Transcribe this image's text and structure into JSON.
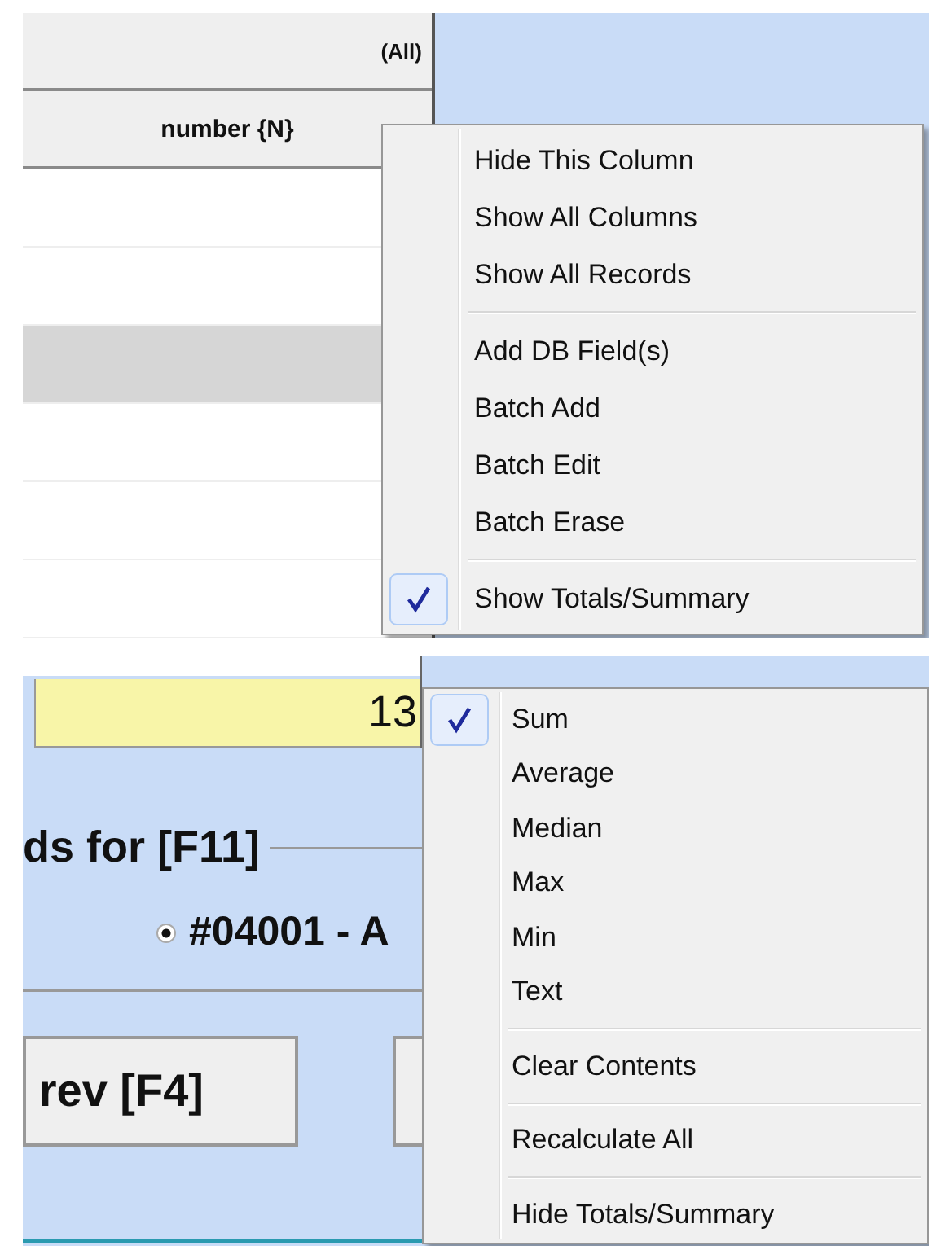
{
  "top_grid": {
    "filter_header": "(All)",
    "column_header": "number {N}",
    "rows": [
      {
        "selected": false
      },
      {
        "selected": false
      },
      {
        "selected": true
      },
      {
        "selected": false
      },
      {
        "selected": false
      },
      {
        "selected": false
      }
    ]
  },
  "column_menu": {
    "groups": [
      {
        "items": [
          {
            "label": "Hide This Column",
            "checked": false
          },
          {
            "label": "Show All Columns",
            "checked": false
          },
          {
            "label": "Show All Records",
            "checked": false
          }
        ]
      },
      {
        "items": [
          {
            "label": "Add DB Field(s)",
            "checked": false
          },
          {
            "label": "Batch Add",
            "checked": false
          },
          {
            "label": "Batch Edit",
            "checked": false
          },
          {
            "label": "Batch Erase",
            "checked": false
          }
        ]
      },
      {
        "items": [
          {
            "label": "Show Totals/Summary",
            "checked": true
          }
        ]
      }
    ]
  },
  "totals_row": {
    "value": "13"
  },
  "group_box": {
    "title": "ds for [F11]",
    "options": [
      {
        "label": "#04001 - A",
        "selected": true
      }
    ]
  },
  "buttons": [
    {
      "label": "rev [F4]"
    }
  ],
  "totals_menu": {
    "groups": [
      {
        "items": [
          {
            "label": "Sum",
            "checked": true
          },
          {
            "label": "Average",
            "checked": false
          },
          {
            "label": "Median",
            "checked": false
          },
          {
            "label": "Max",
            "checked": false
          },
          {
            "label": "Min",
            "checked": false
          },
          {
            "label": "Text",
            "checked": false
          }
        ]
      },
      {
        "items": [
          {
            "label": "Clear Contents",
            "checked": false
          }
        ]
      },
      {
        "items": [
          {
            "label": "Recalculate All",
            "checked": false
          }
        ]
      },
      {
        "items": [
          {
            "label": "Hide Totals/Summary",
            "checked": false
          }
        ]
      }
    ]
  }
}
